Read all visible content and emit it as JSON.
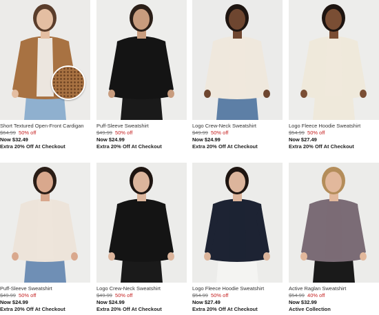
{
  "products": [
    {
      "name": "Short Textured Open-Front Cardigan",
      "orig": "$64.99",
      "off": "50% off",
      "now": "Now $32.49",
      "promo": "Extra 20% Off At Checkout",
      "bg": "#ecebe9",
      "garment": "#a87242",
      "inner": "#f3f3f1",
      "pants": "#8fb0cf",
      "skin": "#e4bea2",
      "hair": "#5a3d2b"
    },
    {
      "name": "Puff-Sleeve Sweatshirt",
      "orig": "$49.99",
      "off": "50% off",
      "now": "Now $24.99",
      "promo": "Extra 20% Off At Checkout",
      "bg": "#ededeb",
      "garment": "#141414",
      "inner": "#141414",
      "pants": "#1a1a1a",
      "skin": "#c89c7e",
      "hair": "#2b1f18"
    },
    {
      "name": "Logo Crew-Neck Sweatshirt",
      "orig": "$49.99",
      "off": "50% off",
      "now": "Now $24.99",
      "promo": "Extra 20% Off At Checkout",
      "bg": "#ebebea",
      "garment": "#efe8dd",
      "inner": "#efe8dd",
      "pants": "#5d7fa6",
      "skin": "#6e4630",
      "hair": "#1e1511"
    },
    {
      "name": "Logo Fleece Hoodie Sweatshirt",
      "orig": "$54.99",
      "off": "50% off",
      "now": "Now $27.49",
      "promo": "Extra 20% Off At Checkout",
      "bg": "#ededeb",
      "garment": "#efe9db",
      "inner": "#efe9db",
      "pants": "#efe9db",
      "skin": "#7a4e34",
      "hair": "#1e1511"
    },
    {
      "name": "Puff-Sleeve Sweatshirt",
      "orig": "$49.99",
      "off": "50% off",
      "now": "Now $24.99",
      "promo": "Extra 20% Off At Checkout",
      "bg": "#ededeb",
      "garment": "#ede4da",
      "inner": "#ede4da",
      "pants": "#6f8fb5",
      "skin": "#d9a88d",
      "hair": "#2a1d16"
    },
    {
      "name": "Logo Crew-Neck Sweatshirt",
      "orig": "$49.99",
      "off": "50% off",
      "now": "Now $24.99",
      "promo": "Extra 20% Off At Checkout",
      "bg": "#ececea",
      "garment": "#141414",
      "inner": "#141414",
      "pants": "#1a1a1a",
      "skin": "#dcb59c",
      "hair": "#1e1511"
    },
    {
      "name": "Logo Fleece Hoodie Sweatshirt",
      "orig": "$54.99",
      "off": "50% off",
      "now": "Now $27.49",
      "promo": "Extra 20% Off At Checkout",
      "bg": "#ececea",
      "garment": "#1d2333",
      "inner": "#1d2333",
      "pants": "#f4f4f2",
      "skin": "#dcb59c",
      "hair": "#1e1511"
    },
    {
      "name": "Active Raglan Sweatshirt",
      "orig": "$54.99",
      "off": "40% off",
      "now": "Now $32.99",
      "promo": "Active Collection",
      "bg": "#ececea",
      "garment": "#7b6c76",
      "inner": "#7b6c76",
      "pants": "#1a1a1a",
      "skin": "#e2b89c",
      "hair": "#b48d5a"
    }
  ]
}
